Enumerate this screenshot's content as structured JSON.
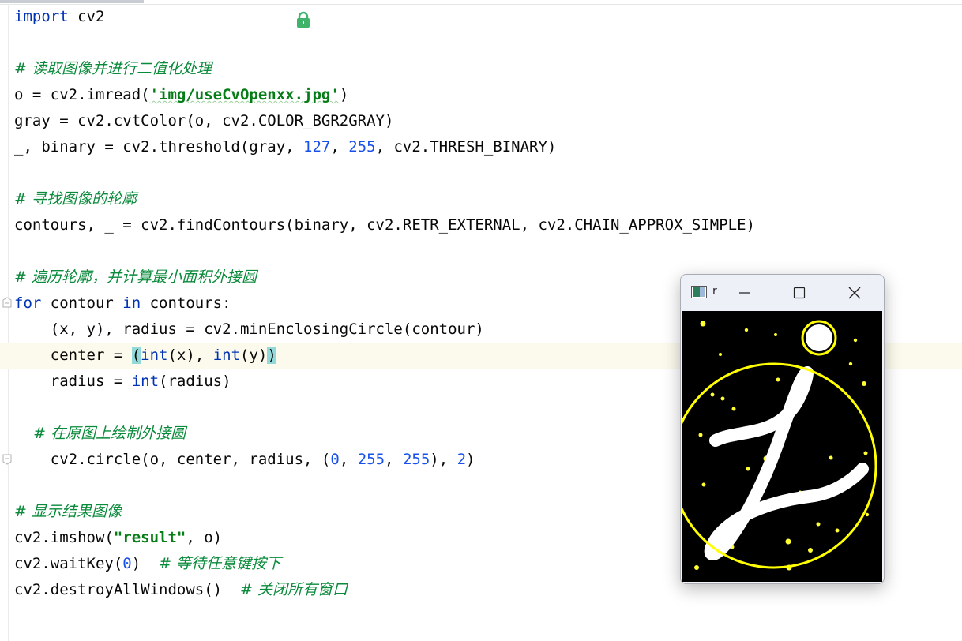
{
  "editor": {
    "lines": [
      {
        "id": "l1",
        "segments": [
          {
            "t": "import",
            "c": "kw"
          },
          {
            "t": " cv2",
            "c": ""
          }
        ]
      },
      {
        "id": "l2",
        "segments": []
      },
      {
        "id": "l3",
        "segments": [
          {
            "t": "# ",
            "c": "cmt-green"
          },
          {
            "t": "读取图像并进行二值化处理",
            "c": "cmt-green"
          }
        ]
      },
      {
        "id": "l4",
        "segments": [
          {
            "t": "o = cv2.imread(",
            "c": ""
          },
          {
            "t": "'img/useCvOpenxx.jpg'",
            "c": "str"
          },
          {
            "t": ")",
            "c": ""
          }
        ]
      },
      {
        "id": "l5",
        "segments": [
          {
            "t": "gray = cv2.cvtColor(o, cv2.COLOR_BGR2GRAY)",
            "c": ""
          }
        ]
      },
      {
        "id": "l6",
        "segments": [
          {
            "t": "_, binary = cv2.threshold(gray, ",
            "c": ""
          },
          {
            "t": "127",
            "c": "num"
          },
          {
            "t": ", ",
            "c": ""
          },
          {
            "t": "255",
            "c": "num"
          },
          {
            "t": ", cv2.THRESH_BINARY)",
            "c": ""
          }
        ]
      },
      {
        "id": "l7",
        "segments": []
      },
      {
        "id": "l8",
        "segments": [
          {
            "t": "# ",
            "c": "cmt-green"
          },
          {
            "t": "寻找图像的轮廓",
            "c": "cmt-green"
          }
        ]
      },
      {
        "id": "l9",
        "segments": [
          {
            "t": "contours, _ = cv2.findContours(binary, cv2.RETR_EXTERNAL, cv2.CHAIN_APPROX_SIMPLE)",
            "c": ""
          }
        ]
      },
      {
        "id": "l10",
        "segments": []
      },
      {
        "id": "l11",
        "segments": [
          {
            "t": "# ",
            "c": "cmt-green"
          },
          {
            "t": "遍历轮廓，并计算最小面积外接圆",
            "c": "cmt-green"
          }
        ]
      },
      {
        "id": "l12",
        "segments": [
          {
            "t": "for",
            "c": "kw"
          },
          {
            "t": " contour ",
            "c": ""
          },
          {
            "t": "in",
            "c": "kw"
          },
          {
            "t": " contours:",
            "c": ""
          }
        ]
      },
      {
        "id": "l13",
        "segments": [
          {
            "t": "    (x, y), radius = cv2.minEnclosingCircle(contour)",
            "c": ""
          }
        ]
      },
      {
        "id": "l14",
        "segments": [
          {
            "t": "    center = ",
            "c": ""
          },
          {
            "t": "(",
            "c": "brace-hl"
          },
          {
            "t": "int",
            "c": "kw"
          },
          {
            "t": "(x), ",
            "c": ""
          },
          {
            "t": "int",
            "c": "kw"
          },
          {
            "t": "(y)",
            "c": ""
          },
          {
            "t": ")",
            "c": "brace-hl"
          }
        ]
      },
      {
        "id": "l15",
        "segments": [
          {
            "t": "    radius = ",
            "c": ""
          },
          {
            "t": "int",
            "c": "kw"
          },
          {
            "t": "(radius)",
            "c": ""
          }
        ]
      },
      {
        "id": "l16",
        "segments": []
      },
      {
        "id": "l17",
        "segments": [
          {
            "t": "    # ",
            "c": "cmt-green"
          },
          {
            "t": "在原图上绘制外接圆",
            "c": "cmt-green"
          }
        ]
      },
      {
        "id": "l18",
        "segments": [
          {
            "t": "    cv2.circle(o, center, radius, (",
            "c": ""
          },
          {
            "t": "0",
            "c": "num"
          },
          {
            "t": ", ",
            "c": ""
          },
          {
            "t": "255",
            "c": "num"
          },
          {
            "t": ", ",
            "c": ""
          },
          {
            "t": "255",
            "c": "num"
          },
          {
            "t": "), ",
            "c": ""
          },
          {
            "t": "2",
            "c": "num"
          },
          {
            "t": ")",
            "c": ""
          }
        ]
      },
      {
        "id": "l19",
        "segments": []
      },
      {
        "id": "l20",
        "segments": [
          {
            "t": "# ",
            "c": "cmt-green"
          },
          {
            "t": "显示结果图像",
            "c": "cmt-green"
          }
        ]
      },
      {
        "id": "l21",
        "segments": [
          {
            "t": "cv2.imshow(",
            "c": ""
          },
          {
            "t": "\"result\"",
            "c": "str"
          },
          {
            "t": ", o)",
            "c": ""
          }
        ]
      },
      {
        "id": "l22",
        "segments": [
          {
            "t": "cv2.waitKey(",
            "c": ""
          },
          {
            "t": "0",
            "c": "num"
          },
          {
            "t": ")  ",
            "c": ""
          },
          {
            "t": "# ",
            "c": "cmt-green"
          },
          {
            "t": "等待任意键按下",
            "c": "cmt-green"
          }
        ]
      },
      {
        "id": "l23",
        "segments": [
          {
            "t": "cv2.destroyAllWindows()  ",
            "c": ""
          },
          {
            "t": "# ",
            "c": "cmt-green"
          },
          {
            "t": "关闭所有窗口",
            "c": "cmt-green"
          }
        ]
      }
    ],
    "current_line_index": 13
  },
  "result_window": {
    "title": "r",
    "icons": {
      "app": "window-app-icon",
      "minimize": "minimize-icon",
      "maximize": "maximize-icon",
      "close": "close-icon"
    }
  },
  "colors": {
    "keyword": "#0033b3",
    "number": "#1750eb",
    "string": "#067d17",
    "comment": "#0a8a3b",
    "current_line": "#fcfaed",
    "brace_highlight": "#93d9d9",
    "circle": "#ffff00"
  }
}
